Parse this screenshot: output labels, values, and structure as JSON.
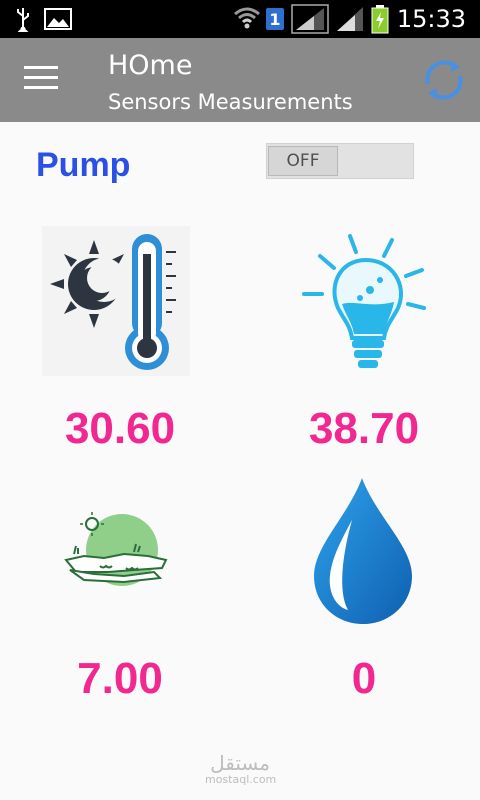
{
  "status_bar": {
    "time": "15:33",
    "sim_badge": "1",
    "icons": [
      "usb-icon",
      "image-icon",
      "wifi-icon",
      "sim-icon",
      "signal-icon",
      "signal-icon",
      "battery-charging-icon"
    ]
  },
  "app_bar": {
    "title": "HOme",
    "subtitle": "Sensors Measurements",
    "menu_icon": "menu-icon",
    "refresh_icon": "refresh-icon"
  },
  "pump": {
    "label": "Pump",
    "toggle_state": "OFF"
  },
  "sensors": [
    {
      "icon": "temperature-icon",
      "value": "30.60"
    },
    {
      "icon": "light-bulb-icon",
      "value": "38.70"
    },
    {
      "icon": "soil-icon",
      "value": "7.00"
    },
    {
      "icon": "water-drop-icon",
      "value": "0"
    }
  ],
  "watermark": {
    "main": "مستقل",
    "sub": "mostaql.com"
  },
  "colors": {
    "app_bar": "#8a8a8a",
    "pump_label": "#2a50e6",
    "value_text": "#f0288f",
    "refresh_icon": "#4a90e2"
  }
}
